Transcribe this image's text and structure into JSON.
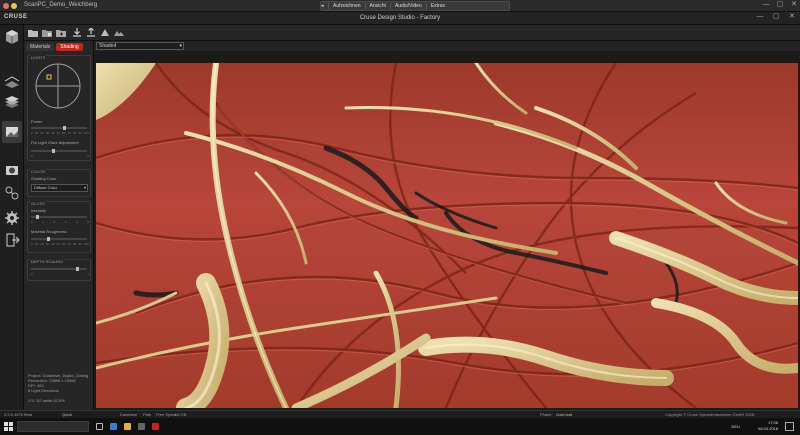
{
  "window": {
    "title": "ScanPC_Demo_Weichberg",
    "controls": [
      "—",
      "▢",
      "✕"
    ]
  },
  "rdp_toolbar": {
    "items": [
      "Aufzeichnen",
      "Ansicht",
      "Audio/Video",
      "Extras"
    ]
  },
  "app": {
    "logo": "CRUSE",
    "title": "Cruse Design Studio - Factory"
  },
  "panel": {
    "tabs": [
      "Materials",
      "Shading"
    ],
    "active_tab": "Shading",
    "lights": {
      "title": "LIGHTS",
      "power_label": "Power",
      "power_ticks": [
        "0",
        "10",
        "20",
        "30",
        "40",
        "50",
        "60",
        "70",
        "80",
        "90",
        "100"
      ],
      "power_value": 60,
      "angle_label": "For Light Glare Adjustment",
      "angle_ticks": [
        "0",
        "",
        "",
        "5"
      ],
      "angle_value": 40
    },
    "color": {
      "title": "COLOR",
      "shading_label": "Shading Color",
      "shading_value": "Diffuse Color"
    },
    "gloss": {
      "title": "GLOSS",
      "intensity_label": "Intensity",
      "intensity_ticks": [
        "0",
        "1",
        "2",
        "3",
        "4",
        "5"
      ],
      "intensity_value": 10,
      "roughness_label": "Material Roughness",
      "roughness_ticks": [
        "0",
        "10",
        "20",
        "30",
        "40",
        "50",
        "60",
        "70",
        "80",
        "90",
        "100"
      ],
      "roughness_value": 30
    },
    "depth": {
      "title": "DEPTH SCALING",
      "ticks": [
        "0",
        "",
        "",
        "",
        "1"
      ],
      "value": 85
    },
    "info": "Project: Goldlinsel_Digital_Gilding\nResolution: 13898 x 15968\nDPI: 400\n8 Light Directions\n\n2.5 / 52 tablet 82.6%"
  },
  "viewport": {
    "shading_mode": "Shaded"
  },
  "statusbar": {
    "version": "2.9.6.4576 Beta",
    "mode": "Quick",
    "database": "Database",
    "path": "Path",
    "free_space_label": "Free Space:",
    "free_space": "1.6 GB",
    "phase_label": "Phase:",
    "phase_value": "Gold leaf",
    "copyright": "Copyright © Cruse Spezialmaschinen GmbH 2018"
  },
  "taskbar": {
    "time": "17:06",
    "date": "06.03.2018",
    "lang": "DEU"
  },
  "colors": {
    "accent": "#c0271f",
    "panel_bg": "#262626",
    "paint_red": "#b1402e",
    "gold": "#d8c48a"
  }
}
